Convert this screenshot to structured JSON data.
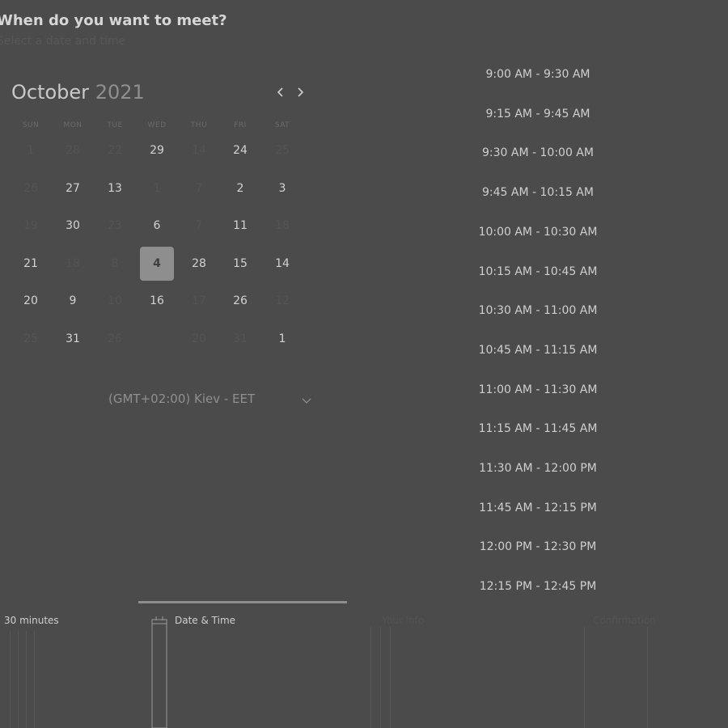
{
  "header": {
    "title": "When do you want to meet?",
    "subtitle": "Select a date and time"
  },
  "calendar": {
    "month": "October",
    "year": "2021",
    "weekdays": [
      "SUN",
      "MON",
      "TUE",
      "WED",
      "THU",
      "FRI",
      "SAT"
    ],
    "rows": [
      [
        {
          "d": "1",
          "s": "dim"
        },
        {
          "d": "28",
          "s": "dim"
        },
        {
          "d": "22",
          "s": "dim"
        },
        {
          "d": "29",
          "s": "active"
        },
        {
          "d": "14",
          "s": "dim"
        },
        {
          "d": "24",
          "s": "active"
        },
        {
          "d": "25",
          "s": "dim"
        }
      ],
      [
        {
          "d": "26",
          "s": "dim"
        },
        {
          "d": "27",
          "s": "active"
        },
        {
          "d": "13",
          "s": "active"
        },
        {
          "d": "1",
          "s": "dim"
        },
        {
          "d": "7",
          "s": "dim"
        },
        {
          "d": "2",
          "s": "active"
        },
        {
          "d": "3",
          "s": "active"
        }
      ],
      [
        {
          "d": "19",
          "s": "dim"
        },
        {
          "d": "30",
          "s": "active"
        },
        {
          "d": "23",
          "s": "dim"
        },
        {
          "d": "6",
          "s": "active"
        },
        {
          "d": "7",
          "s": "dim"
        },
        {
          "d": "11",
          "s": "active"
        },
        {
          "d": "18",
          "s": "dim"
        }
      ],
      [
        {
          "d": "21",
          "s": "active"
        },
        {
          "d": "18",
          "s": "dim"
        },
        {
          "d": "8",
          "s": "dim"
        },
        {
          "d": "4",
          "s": "selected"
        },
        {
          "d": "28",
          "s": "active"
        },
        {
          "d": "15",
          "s": "active"
        },
        {
          "d": "14",
          "s": "active"
        }
      ],
      [
        {
          "d": "20",
          "s": "active"
        },
        {
          "d": "9",
          "s": "active"
        },
        {
          "d": "10",
          "s": "dim"
        },
        {
          "d": "16",
          "s": "active"
        },
        {
          "d": "17",
          "s": "dim"
        },
        {
          "d": "26",
          "s": "active"
        },
        {
          "d": "12",
          "s": "dim"
        }
      ],
      [
        {
          "d": "25",
          "s": "dim"
        },
        {
          "d": "31",
          "s": "active"
        },
        {
          "d": "26",
          "s": "dim"
        },
        {
          "d": "",
          "s": "dim"
        },
        {
          "d": "20",
          "s": "dim"
        },
        {
          "d": "31",
          "s": "dim"
        },
        {
          "d": "1",
          "s": "active"
        }
      ]
    ]
  },
  "timezone": {
    "label": "(GMT+02:00) Kiev - EET"
  },
  "time_slots": [
    "9:00 AM - 9:30 AM",
    "9:15 AM - 9:45 AM",
    "9:30 AM - 10:00 AM",
    "9:45 AM - 10:15 AM",
    "10:00 AM - 10:30 AM",
    "10:15 AM - 10:45 AM",
    "10:30 AM - 11:00 AM",
    "10:45 AM - 11:15 AM",
    "11:00 AM - 11:30 AM",
    "11:15 AM - 11:45 AM",
    "11:30 AM - 12:00 PM",
    "11:45 AM - 12:15 PM",
    "12:00 PM - 12:30 PM",
    "12:15 PM - 12:45 PM"
  ],
  "steps": {
    "duration": "30 minutes",
    "date_time": "Date & Time",
    "details": "Your Info",
    "confirm": "Confirmation"
  },
  "colors": {
    "background": "#4b4b4b",
    "selected_day": "#8e8e8e",
    "active_text": "#cfcfcf",
    "dim_text": "#545454"
  }
}
